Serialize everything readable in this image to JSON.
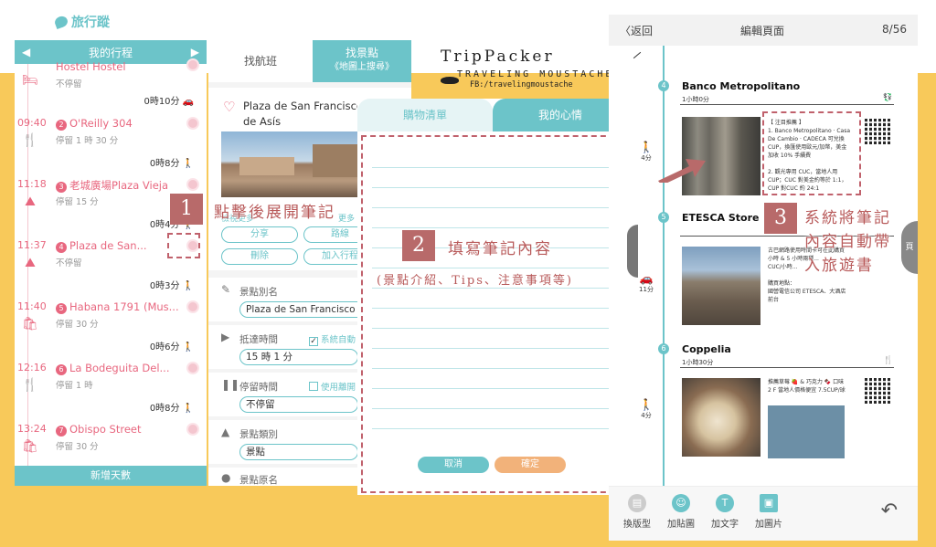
{
  "logo": {
    "text": "旅行蹤"
  },
  "brand": {
    "name": "TripPacker",
    "tagline": "TRAVELING MOUSTACHE",
    "fb": "FB:/travelingmoustache"
  },
  "left": {
    "header": "我的行程",
    "footer": "新增天數",
    "top_partial": "Hostel Hostel",
    "top_stay": "不停留",
    "first_travel": "0時10分",
    "rows": [
      {
        "time": "09:40",
        "num": "2",
        "name": "O'Reilly 304",
        "stay": "停留 1 時 30 分",
        "travel": "0時8分"
      },
      {
        "time": "11:18",
        "num": "3",
        "name": "老城廣場Plaza Vieja",
        "stay": "停留 15 分",
        "travel": "0時4分"
      },
      {
        "time": "11:37",
        "num": "4",
        "name": "Plaza de San...",
        "stay": "不停留",
        "travel": "0時3分"
      },
      {
        "time": "11:40",
        "num": "5",
        "name": "Habana 1791 (Mus...",
        "stay": "停留 30 分",
        "travel": "0時6分"
      },
      {
        "time": "12:16",
        "num": "6",
        "name": "La Bodeguita Del...",
        "stay": "停留 1 時",
        "travel": "0時8分"
      },
      {
        "time": "13:24",
        "num": "7",
        "name": "Obispo Street",
        "stay": "停留 30 分",
        "travel": ""
      }
    ]
  },
  "right": {
    "tab_flight": "找航班",
    "tab_spot": "找景點",
    "tab_spot_sub": "《地圖上搜尋》",
    "place_name": "Plaza de San Francisco de Asís",
    "link_detail": "檢視更多",
    "link_more": "更多",
    "btn_share": "分享",
    "btn_route": "路線",
    "btn_delete": "刪除",
    "btn_add": "加入行程",
    "alias_label": "景點別名",
    "alias_value": "Plaza de San Francisco d",
    "arrive_label": "抵達時間",
    "arrive_check": "系統自動",
    "arrive_value": "15 時 1 分",
    "stay_label": "停留時間",
    "stay_check": "使用離開",
    "stay_value": "不停留",
    "type_label": "景點類別",
    "type_value": "景點",
    "origin_label": "景點原名"
  },
  "modal": {
    "tab_shopping": "購物清單",
    "tab_notes": "我的心情",
    "cancel": "取消",
    "confirm": "確定"
  },
  "annotations": {
    "step1_num": "1",
    "step1_text": "點擊後展開筆記",
    "step2_num": "2",
    "step2_text": "填寫筆記內容",
    "step2_sub": "(景點介紹、Tips、注意事項等)",
    "step3_num": "3",
    "step3_l1": "系統將筆記",
    "step3_l2": "內容自動帶",
    "step3_l3": "入旅遊書"
  },
  "book": {
    "back": "返回",
    "title": "編輯頁面",
    "page": "8/56",
    "entries": [
      {
        "num": "4",
        "name": "Banco Metropolitano",
        "dur": "1小時0分",
        "text": "【 注目推薦 】\n1. Banco Metropolitano · Casa\nDe Cambio · CADECA 可兌換\nCUP，換匯使用歐元/加幣，美金\n加收 10% 手續費\n\n2. 觀光專用 CUC，當地人用\nCUP；CUC 對美金約等於 1:1，\nCUP 對CUC 約 24:1"
      },
      {
        "num": "5",
        "name": "ETESCA Store",
        "dur": "",
        "text": "古巴網路使用時間卡可在此購買\n小時 & 5 小時兩種...\nCUC/小時...\n\n購買地點：\n國營電信公司 ETESCA、大酒店\n前台"
      },
      {
        "num": "6",
        "name": "Coppelia",
        "dur": "1小時30分",
        "text": "推薦草莓 🍓 & 巧克力 🍫 口味\n2 F 當地人價格便宜 7.5CUP/球"
      }
    ],
    "modes": [
      {
        "label": "4分"
      },
      {
        "label": "11分"
      },
      {
        "label": "4分"
      }
    ],
    "tools": [
      "換版型",
      "加貼圖",
      "加文字",
      "加圖片"
    ],
    "side_right": "頁"
  }
}
